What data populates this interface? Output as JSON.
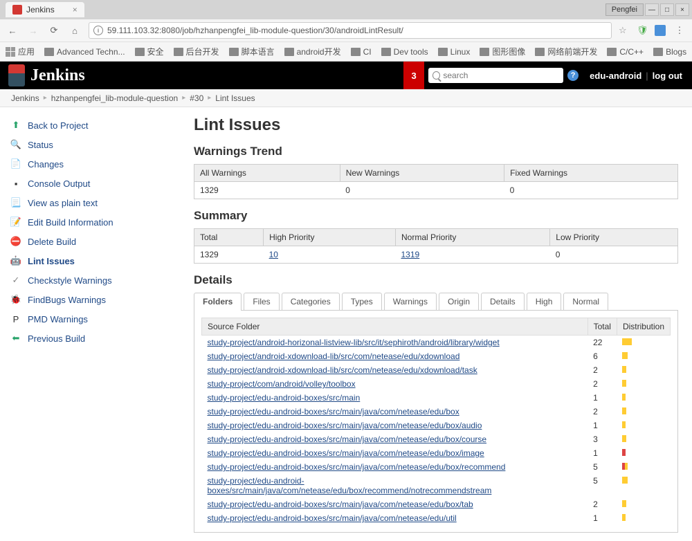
{
  "browser": {
    "tab_title": "Jenkins",
    "user_label": "Pengfei",
    "url": "59.111.103.32:8080/job/hzhanpengfei_lib-module-question/30/androidLintResult/",
    "bookmarks_label": "应用",
    "bookmarks": [
      "Advanced Techn...",
      "安全",
      "后台开发",
      "脚本语言",
      "android开发",
      "CI",
      "Dev tools",
      "Linux",
      "图形图像",
      "网络前端开发",
      "C/C++",
      "Blogs"
    ]
  },
  "header": {
    "logo": "Jenkins",
    "notif_count": "3",
    "search_placeholder": "search",
    "user": "edu-android",
    "logout": "log out"
  },
  "breadcrumbs": [
    "Jenkins",
    "hzhanpengfei_lib-module-question",
    "#30",
    "Lint Issues"
  ],
  "sidebar": [
    {
      "label": "Back to Project",
      "icon": "arrow-up",
      "color": "#26a269"
    },
    {
      "label": "Status",
      "icon": "magnifier",
      "color": "#888"
    },
    {
      "label": "Changes",
      "icon": "doc",
      "color": "#ca8"
    },
    {
      "label": "Console Output",
      "icon": "terminal",
      "color": "#333"
    },
    {
      "label": "View as plain text",
      "icon": "doc-text",
      "color": "#888"
    },
    {
      "label": "Edit Build Information",
      "icon": "doc-edit",
      "color": "#ca8"
    },
    {
      "label": "Delete Build",
      "icon": "no-entry",
      "color": "#d44"
    },
    {
      "label": "Lint Issues",
      "icon": "android",
      "color": "#a4c639",
      "active": true
    },
    {
      "label": "Checkstyle Warnings",
      "icon": "check",
      "color": "#888"
    },
    {
      "label": "FindBugs Warnings",
      "icon": "bug",
      "color": "#d44"
    },
    {
      "label": "PMD Warnings",
      "icon": "pmd",
      "color": "#333"
    },
    {
      "label": "Previous Build",
      "icon": "arrow-left",
      "color": "#26a269"
    }
  ],
  "page": {
    "title": "Lint Issues",
    "trend_title": "Warnings Trend",
    "trend_headers": [
      "All Warnings",
      "New Warnings",
      "Fixed Warnings"
    ],
    "trend_values": [
      "1329",
      "0",
      "0"
    ],
    "summary_title": "Summary",
    "summary_headers": [
      "Total",
      "High Priority",
      "Normal Priority",
      "Low Priority"
    ],
    "summary_values": [
      "1329",
      "10",
      "1319",
      "0"
    ],
    "details_title": "Details",
    "tabs": [
      "Folders",
      "Files",
      "Categories",
      "Types",
      "Warnings",
      "Origin",
      "Details",
      "High",
      "Normal"
    ],
    "folder_headers": [
      "Source Folder",
      "Total",
      "Distribution"
    ],
    "folders": [
      {
        "path": "study-project/android-horizonal-listview-lib/src/it/sephiroth/android/library/widget",
        "total": "22",
        "dist": [
          {
            "w": 14,
            "c": "#fc3"
          }
        ]
      },
      {
        "path": "study-project/android-xdownload-lib/src/com/netease/edu/xdownload",
        "total": "6",
        "dist": [
          {
            "w": 8,
            "c": "#fc3"
          }
        ]
      },
      {
        "path": "study-project/android-xdownload-lib/src/com/netease/edu/xdownload/task",
        "total": "2",
        "dist": [
          {
            "w": 6,
            "c": "#fc3"
          }
        ]
      },
      {
        "path": "study-project/com/android/volley/toolbox",
        "total": "2",
        "dist": [
          {
            "w": 6,
            "c": "#fc3"
          }
        ]
      },
      {
        "path": "study-project/edu-android-boxes/src/main",
        "total": "1",
        "dist": [
          {
            "w": 5,
            "c": "#fc3"
          }
        ]
      },
      {
        "path": "study-project/edu-android-boxes/src/main/java/com/netease/edu/box",
        "total": "2",
        "dist": [
          {
            "w": 6,
            "c": "#fc3"
          }
        ]
      },
      {
        "path": "study-project/edu-android-boxes/src/main/java/com/netease/edu/box/audio",
        "total": "1",
        "dist": [
          {
            "w": 5,
            "c": "#fc3"
          }
        ]
      },
      {
        "path": "study-project/edu-android-boxes/src/main/java/com/netease/edu/box/course",
        "total": "3",
        "dist": [
          {
            "w": 6,
            "c": "#fc3"
          }
        ]
      },
      {
        "path": "study-project/edu-android-boxes/src/main/java/com/netease/edu/box/image",
        "total": "1",
        "dist": [
          {
            "w": 5,
            "c": "#d44"
          }
        ]
      },
      {
        "path": "study-project/edu-android-boxes/src/main/java/com/netease/edu/box/recommend",
        "total": "5",
        "dist": [
          {
            "w": 4,
            "c": "#d44"
          },
          {
            "w": 4,
            "c": "#fc3"
          }
        ]
      },
      {
        "path": "study-project/edu-android-boxes/src/main/java/com/netease/edu/box/recommend/notrecommendstream",
        "total": "5",
        "dist": [
          {
            "w": 8,
            "c": "#fc3"
          }
        ]
      },
      {
        "path": "study-project/edu-android-boxes/src/main/java/com/netease/edu/box/tab",
        "total": "2",
        "dist": [
          {
            "w": 6,
            "c": "#fc3"
          }
        ]
      },
      {
        "path": "study-project/edu-android-boxes/src/main/java/com/netease/edu/util",
        "total": "1",
        "dist": [
          {
            "w": 5,
            "c": "#fc3"
          }
        ]
      }
    ]
  }
}
